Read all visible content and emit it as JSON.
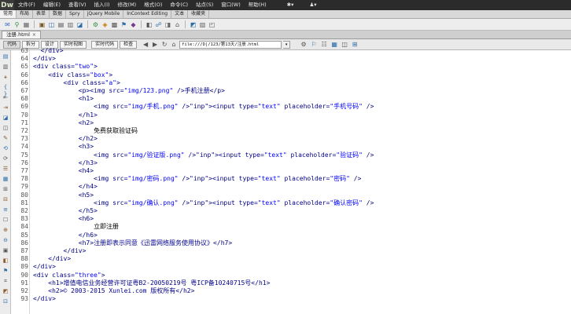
{
  "menubar": {
    "logo": "Dw",
    "items": [
      "文件(F)",
      "编辑(E)",
      "查看(V)",
      "插入(I)",
      "修改(M)",
      "格式(O)",
      "命令(C)",
      "站点(S)",
      "窗口(W)",
      "帮助(H)"
    ],
    "right_icons": [
      "gear-icon",
      "user-icon"
    ],
    "right_glyphs": [
      "✱▾",
      "♟▾"
    ]
  },
  "insert_tabs": [
    "常用",
    "布局",
    "表单",
    "数据",
    "Spry",
    "jQuery Mobile",
    "InContext Editing",
    "文本",
    "收藏夹"
  ],
  "active_insert_tab": 0,
  "toolbar_icons": [
    "✉",
    "⚲",
    "▦",
    "▣",
    "◫",
    "▤",
    "▥",
    "◪",
    "⚙",
    "◈",
    "▩",
    "⚑",
    "◆",
    "◧",
    "☍",
    "◨",
    "⌂",
    "◩",
    "▧",
    "◰"
  ],
  "document": {
    "tab_label": "注册.html",
    "close_glyph": "×"
  },
  "viewbar": {
    "code_label": "代码",
    "split_label": "拆分",
    "design_label": "设计",
    "live_view_label": "实时视图",
    "live_code_label": "实时代码",
    "inspect_label": "检查",
    "address": "file:///D|/123/第13天/注册.html",
    "address_drop": "▾",
    "nav_glyphs": [
      "◀",
      "▶",
      "↻",
      "⌂"
    ],
    "extra_glyphs": [
      "⚙",
      "⚐",
      "☷",
      "▦",
      "◫",
      "⊞"
    ]
  },
  "side_icons": [
    "▤",
    "▥",
    "⚹",
    "{ }",
    "⇤",
    "⇥",
    "◪",
    "◫",
    "✎",
    "⟲",
    "⟳",
    "☰",
    "▦",
    "⊞",
    "⊟",
    "≡",
    "☐",
    "⊕",
    "⊖",
    "▣",
    "◧",
    "⚑",
    "⌗",
    "◩",
    "⊡"
  ],
  "code_lines": [
    {
      "n": "63",
      "indent": "  ",
      "text": "</div>",
      "cls": "tag"
    },
    {
      "n": "64",
      "indent": "",
      "text": "</div>",
      "cls": "tag"
    },
    {
      "n": "65",
      "indent": "",
      "text": "<div class=\"two\">",
      "cls": "tag"
    },
    {
      "n": "66",
      "indent": "    ",
      "text": "<div class=\"box\">",
      "cls": "tag"
    },
    {
      "n": "66",
      "indent": "        ",
      "text": "<div class=\"a\">",
      "cls": "tag"
    },
    {
      "n": "67",
      "indent": "            ",
      "text": "<p><img src=\"img/123.png\" />手机注册</p>",
      "cls": "tag"
    },
    {
      "n": "68",
      "indent": "            ",
      "text": "<h1>",
      "cls": "tag"
    },
    {
      "n": "69",
      "indent": "                ",
      "text": "<img src=\"img/手机.png\" /><input type=\"text\" placeholder=\"手机号码\" />",
      "cls": "tag"
    },
    {
      "n": "70",
      "indent": "            ",
      "text": "</h1>",
      "cls": "tag"
    },
    {
      "n": "71",
      "indent": "            ",
      "text": "<h2>",
      "cls": "tag"
    },
    {
      "n": "72",
      "indent": "                ",
      "text": "免费获取验证码",
      "cls": "txt"
    },
    {
      "n": "73",
      "indent": "            ",
      "text": "</h2>",
      "cls": "tag"
    },
    {
      "n": "74",
      "indent": "            ",
      "text": "<h3>",
      "cls": "tag"
    },
    {
      "n": "75",
      "indent": "                ",
      "text": "<img src=\"img/验证版.png\" /><input type=\"text\" placeholder=\"验证码\" />",
      "cls": "tag"
    },
    {
      "n": "76",
      "indent": "            ",
      "text": "</h3>",
      "cls": "tag"
    },
    {
      "n": "77",
      "indent": "            ",
      "text": "<h4>",
      "cls": "tag"
    },
    {
      "n": "78",
      "indent": "                ",
      "text": "<img src=\"img/密码.png\" /><input type=\"text\" placeholder=\"密码\" />",
      "cls": "tag"
    },
    {
      "n": "79",
      "indent": "            ",
      "text": "</h4>",
      "cls": "tag"
    },
    {
      "n": "80",
      "indent": "            ",
      "text": "<h5>",
      "cls": "tag"
    },
    {
      "n": "81",
      "indent": "                ",
      "text": "<img src=\"img/确认.png\" /><input type=\"text\" placeholder=\"确认密码\" />",
      "cls": "tag"
    },
    {
      "n": "82",
      "indent": "            ",
      "text": "</h5>",
      "cls": "tag"
    },
    {
      "n": "83",
      "indent": "            ",
      "text": "<h6>",
      "cls": "tag"
    },
    {
      "n": "84",
      "indent": "                ",
      "text": "立即注册",
      "cls": "txt"
    },
    {
      "n": "85",
      "indent": "            ",
      "text": "</h6>",
      "cls": "tag"
    },
    {
      "n": "86",
      "indent": "            ",
      "text": "<h7>注册即表示同意《迅雷网络服务使用协议》</h7>",
      "cls": "tag"
    },
    {
      "n": "87",
      "indent": "        ",
      "text": "</div>",
      "cls": "tag"
    },
    {
      "n": "88",
      "indent": "    ",
      "text": "</div>",
      "cls": "tag"
    },
    {
      "n": "89",
      "indent": "",
      "text": "</div>",
      "cls": "tag"
    },
    {
      "n": "90",
      "indent": "",
      "text": "<div class=\"three\">",
      "cls": "tag"
    },
    {
      "n": "91",
      "indent": "    ",
      "text": "<h1>增值电信业务经营许可证粤B2-20050219号 粤ICP备10240715号</h1>",
      "cls": "tag"
    },
    {
      "n": "92",
      "indent": "    ",
      "text": "<h2>© 2003-2015 Xunlei.com 版权所有</h2>",
      "cls": "tag"
    },
    {
      "n": "93",
      "indent": "",
      "text": "</div>",
      "cls": "tag"
    }
  ],
  "colors": {
    "tag": "#000088",
    "attr_value": "#0000ff",
    "input_tag": "#e07a00",
    "menubar_bg": "#2b2b2b"
  }
}
